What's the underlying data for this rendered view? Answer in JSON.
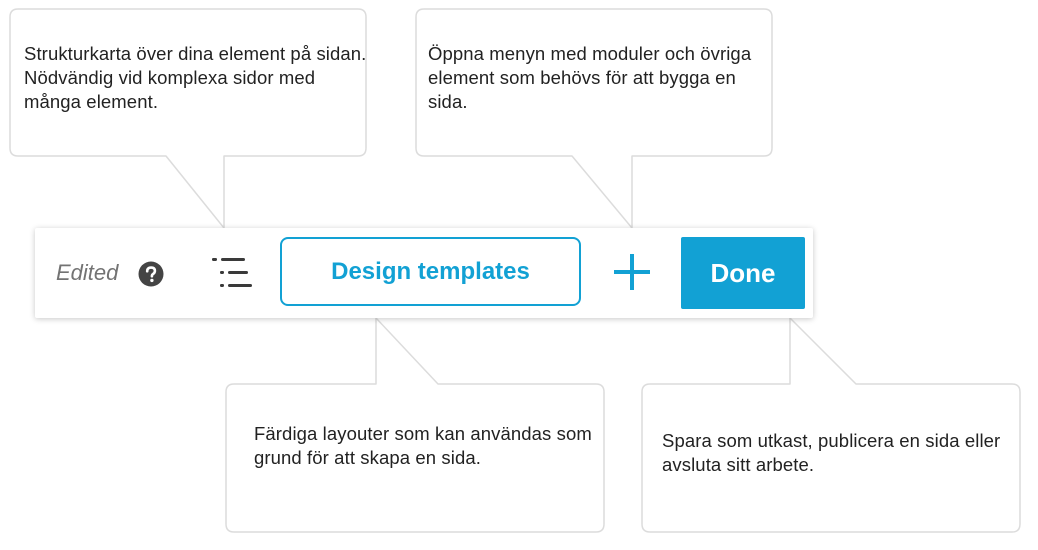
{
  "callouts": {
    "structure_map": "Strukturkarta över dina element på sidan. Nödvändig vid komplexa sidor med många element.",
    "add_menu": "Öppna menyn med moduler och övriga element som behövs för att bygga en sida.",
    "design_templates": "Färdiga layouter som kan användas som grund för att skapa en sida.",
    "done": "Spara som utkast, publicera en sida eller avsluta sitt arbete."
  },
  "toolbar": {
    "status": "Edited",
    "design_templates_label": "Design templates",
    "done_label": "Done"
  },
  "icons": {
    "help": "question-circle-icon",
    "structure": "list-tree-icon",
    "add": "plus-icon"
  },
  "colors": {
    "accent": "#12a1d4",
    "callout_border": "#dcdcdc",
    "text": "#222222",
    "muted": "#737373",
    "icon_dark": "#3a3a3a"
  }
}
